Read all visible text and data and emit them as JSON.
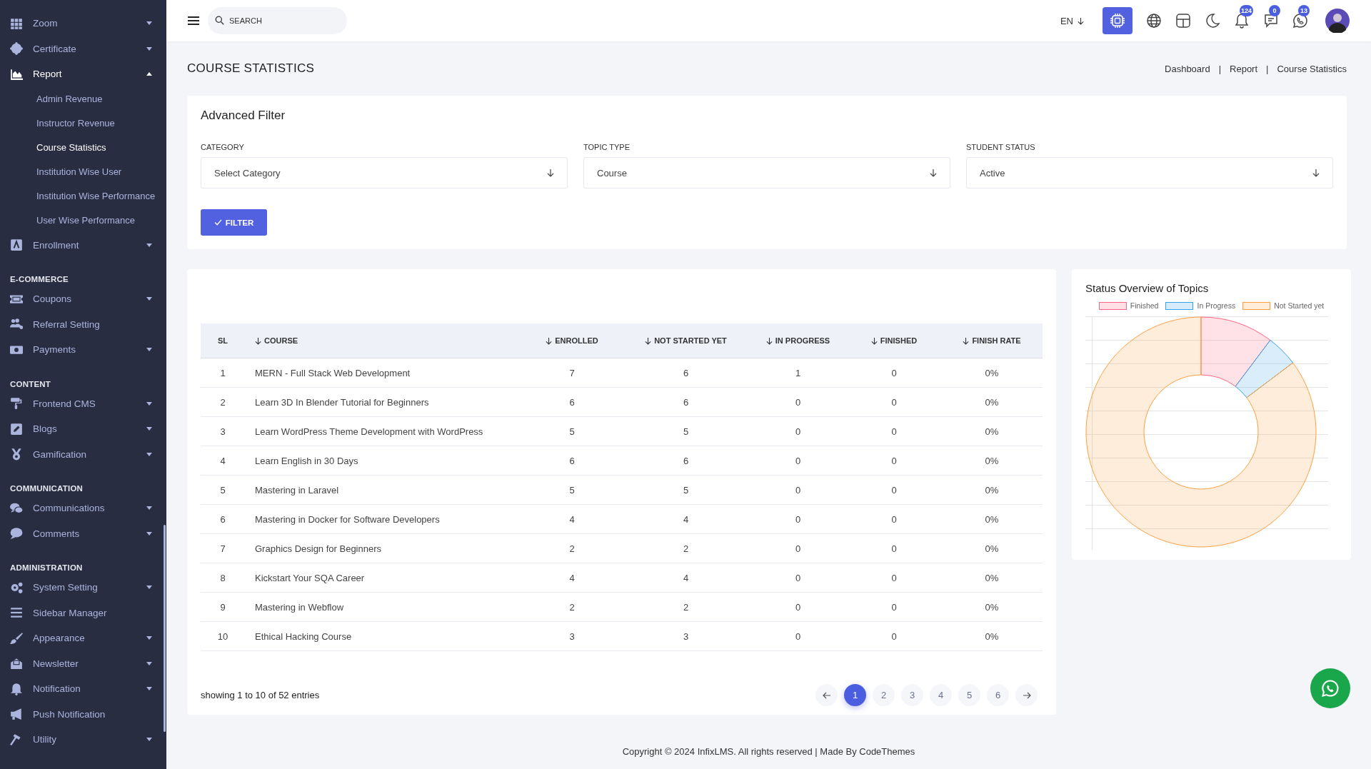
{
  "sidebar": {
    "sections": [
      {
        "items": [
          {
            "label": "Zoom",
            "expanded": false
          },
          {
            "label": "Certificate",
            "expanded": false
          },
          {
            "label": "Report",
            "expanded": true,
            "children": [
              {
                "label": "Admin Revenue",
                "selected": false
              },
              {
                "label": "Instructor Revenue",
                "selected": false
              },
              {
                "label": "Course Statistics",
                "selected": true
              },
              {
                "label": "Institution Wise User",
                "selected": false
              },
              {
                "label": "Institution Wise Performance",
                "selected": false
              },
              {
                "label": "User Wise Performance",
                "selected": false
              }
            ]
          },
          {
            "label": "Enrollment",
            "expanded": false
          }
        ]
      },
      {
        "heading": "E-COMMERCE",
        "items": [
          {
            "label": "Coupons",
            "expanded": false
          },
          {
            "label": "Referral Setting"
          },
          {
            "label": "Payments",
            "expanded": false
          }
        ]
      },
      {
        "heading": "CONTENT",
        "items": [
          {
            "label": "Frontend CMS",
            "expanded": false
          },
          {
            "label": "Blogs",
            "expanded": false
          },
          {
            "label": "Gamification",
            "expanded": false
          }
        ]
      },
      {
        "heading": "COMMUNICATION",
        "items": [
          {
            "label": "Communications",
            "expanded": false
          },
          {
            "label": "Comments",
            "expanded": false
          }
        ]
      },
      {
        "heading": "ADMINISTRATION",
        "items": [
          {
            "label": "System Setting",
            "expanded": false
          },
          {
            "label": "Sidebar Manager"
          },
          {
            "label": "Appearance",
            "expanded": false
          },
          {
            "label": "Newsletter",
            "expanded": false
          },
          {
            "label": "Notification",
            "expanded": false
          },
          {
            "label": "Push Notification"
          },
          {
            "label": "Utility",
            "expanded": false
          }
        ]
      }
    ]
  },
  "topbar": {
    "search": {
      "placeholder": "SEARCH"
    },
    "language": "EN",
    "badges": {
      "notifications": "124",
      "messages": "0",
      "chats": "13"
    }
  },
  "page": {
    "title": "COURSE STATISTICS",
    "breadcrumb": {
      "separator": "|",
      "items": [
        "Dashboard",
        "Report",
        "Course Statistics"
      ]
    }
  },
  "filter": {
    "title": "Advanced Filter",
    "fields": [
      {
        "label": "CATEGORY",
        "value": "Select Category"
      },
      {
        "label": "TOPIC TYPE",
        "value": "Course"
      },
      {
        "label": "STUDENT STATUS",
        "value": "Active"
      }
    ],
    "button": "FILTER"
  },
  "table": {
    "columns": [
      {
        "label": "SL",
        "sortable": false
      },
      {
        "label": "COURSE",
        "sortable": true
      },
      {
        "label": "ENROLLED",
        "sortable": true
      },
      {
        "label": "NOT STARTED YET",
        "sortable": true
      },
      {
        "label": "IN PROGRESS",
        "sortable": true
      },
      {
        "label": "FINISHED",
        "sortable": true
      },
      {
        "label": "FINISH RATE",
        "sortable": true
      }
    ],
    "rows": [
      [
        "1",
        "MERN - Full Stack Web Development",
        "7",
        "6",
        "1",
        "0",
        "0%"
      ],
      [
        "2",
        "Learn 3D In Blender Tutorial for Beginners",
        "6",
        "6",
        "0",
        "0",
        "0%"
      ],
      [
        "3",
        "Learn WordPress Theme Development with WordPress",
        "5",
        "5",
        "0",
        "0",
        "0%"
      ],
      [
        "4",
        "Learn English in 30 Days",
        "6",
        "6",
        "0",
        "0",
        "0%"
      ],
      [
        "5",
        "Mastering in Laravel",
        "5",
        "5",
        "0",
        "0",
        "0%"
      ],
      [
        "6",
        "Mastering in Docker for Software Developers",
        "4",
        "4",
        "0",
        "0",
        "0%"
      ],
      [
        "7",
        "Graphics Design for Beginners",
        "2",
        "2",
        "0",
        "0",
        "0%"
      ],
      [
        "8",
        "Kickstart Your SQA Career",
        "4",
        "4",
        "0",
        "0",
        "0%"
      ],
      [
        "9",
        "Mastering in Webflow",
        "2",
        "2",
        "0",
        "0",
        "0%"
      ],
      [
        "10",
        "Ethical Hacking Course",
        "3",
        "3",
        "0",
        "0",
        "0%"
      ]
    ],
    "info": "showing 1 to 10 of 52 entries",
    "pages": [
      {
        "label": "1",
        "selected": true
      },
      {
        "label": "2",
        "selected": false
      },
      {
        "label": "3",
        "selected": false
      },
      {
        "label": "4",
        "selected": false
      },
      {
        "label": "5",
        "selected": false
      },
      {
        "label": "6",
        "selected": false
      }
    ]
  },
  "status_chart": {
    "title": "Status Overview of Topics",
    "legend": [
      {
        "label": "Finished",
        "color": "#ff6384"
      },
      {
        "label": "In Progress",
        "color": "#36a2eb"
      },
      {
        "label": "Not Started yet",
        "color": "#ff9f40"
      }
    ]
  },
  "footer": "Copyright © 2024 InfixLMS. All rights reserved | Made By CodeThemes"
}
